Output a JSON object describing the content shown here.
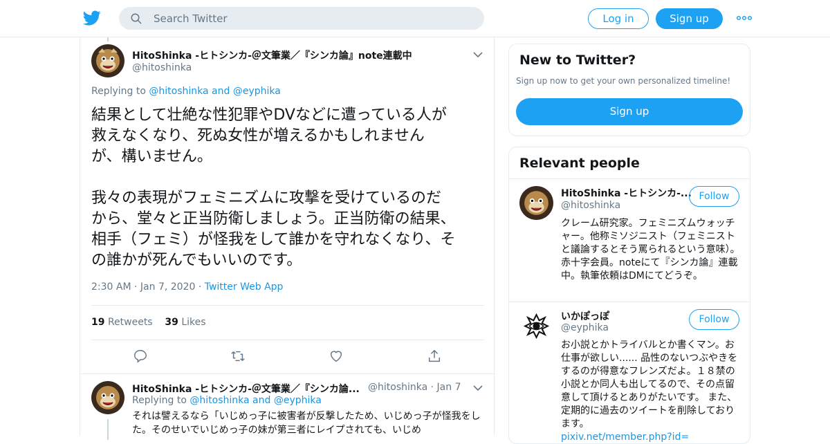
{
  "header": {
    "search_placeholder": "Search Twitter",
    "login_label": "Log in",
    "signup_label": "Sign up",
    "brand_color": "#1da1f2"
  },
  "tweet": {
    "author_name": "HitoShinka -ヒトシンカ-＠文筆業／『シンカ論』note連載中",
    "author_handle": "@hitoshinka",
    "replying_prefix": "Replying to ",
    "replying_user1": "@hitoshinka",
    "replying_and": " and ",
    "replying_user2": "@eyphika",
    "text": "結果として壮絶な性犯罪やDVなどに遭っている人が\n救えなくなり、死ぬ女性が増えるかもしれません\nが、構いません。\n\n我々の表現がフェミニズムに攻撃を受けているのだ\nから、堂々と正当防衛しましょう。正当防衛の結果、\n相手（フェミ）が怪我をして誰かを守れなくなり、そ\nの誰かが死んでもいいのです。",
    "time": "2:30 AM",
    "date": "Jan 7, 2020",
    "source": "Twitter Web App",
    "retweets_count": "19",
    "retweets_label": "Retweets",
    "likes_count": "39",
    "likes_label": "Likes"
  },
  "reply2": {
    "author_name": "HitoShinka -ヒトシンカ-＠文筆業／『シンカ論...",
    "author_handle": "@hitoshinka",
    "date": "Jan 7",
    "replying_prefix": "Replying to ",
    "replying_user1": "@hitoshinka",
    "replying_and": " and ",
    "replying_user2": "@eyphika",
    "text": "それは譬えるなら「いじめっ子に被害者が反撃したため、いじめっ子が怪我をした。そのせいでいじめっ子の妹が第三者にレイプされても、いじめ"
  },
  "sidebar": {
    "new_to_twitter": {
      "title": "New to Twitter?",
      "subtitle": "Sign up now to get your own personalized timeline!",
      "button": "Sign up"
    },
    "relevant_people": {
      "title": "Relevant people",
      "people": [
        {
          "name": "HitoShinka -ヒトシンカ-...",
          "handle": "@hitoshinka",
          "follow_label": "Follow",
          "bio": "クレーム研究家。フェミニズムウォッチャー。他称ミソジニスト（フェミニストと議論するとそう罵られるという意味）。赤十字会員。noteにて『シンカ論』連載中。執筆依頼はDMにてどうぞ。"
        },
        {
          "name": "いかぽっぽ",
          "handle": "@eyphika",
          "follow_label": "Follow",
          "bio": "お小説とかトライバルとか書くマン。お仕事が欲しい...... 品性のないつぶやきをするのが得意なフレンズだよ。１８禁の小説とか同人も出してるので、その点留意して頂けるとありがたいです。 また、定期的に過去のツイートを削除しております。",
          "link": "pixiv.net/member.php?id="
        }
      ]
    }
  }
}
